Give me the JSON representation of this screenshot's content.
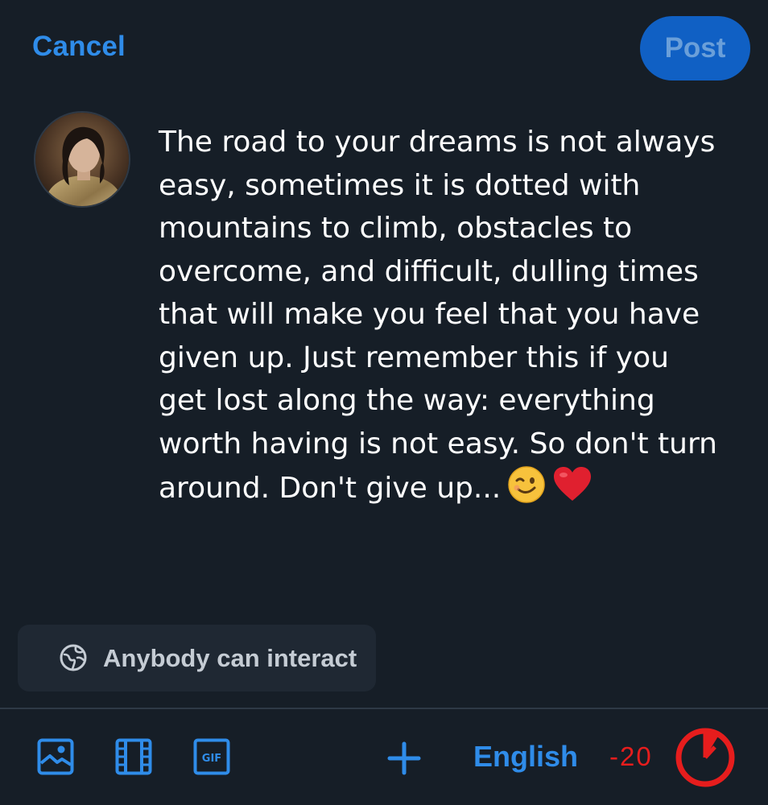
{
  "header": {
    "cancel_label": "Cancel",
    "post_label": "Post"
  },
  "composer": {
    "text": "The road to your dreams is not always easy, sometimes it is dotted with mountains to climb, obstacles to overcome, and difficult, dulling times that will make you feel that you have given up. Just remember this if you get lost along the way: everything worth having is not easy. So don't turn around. Don't give up...",
    "emojis": [
      "wink-emoji",
      "red-heart-emoji"
    ]
  },
  "interaction_settings": {
    "label": "Anybody can interact",
    "icon": "globe-icon"
  },
  "toolbar": {
    "icons": [
      "image-icon",
      "video-icon",
      "gif-icon",
      "plus-icon"
    ],
    "language_label": "English",
    "char_count": "-20",
    "colors": {
      "accent": "#2f8ce9",
      "over_limit": "#e61d1d",
      "background": "#161e27"
    }
  }
}
